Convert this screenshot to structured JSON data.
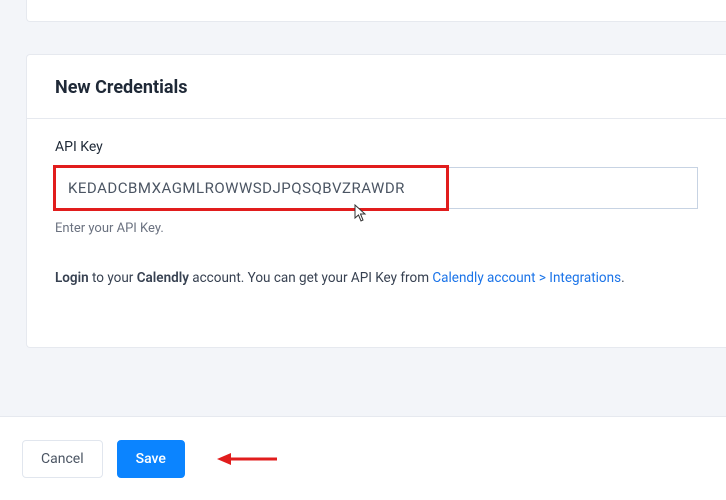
{
  "card": {
    "title": "New Credentials",
    "field_label": "API Key",
    "api_key_value": "KEDADCBMXAGMLROWWSDJPQSQBVZRAWDR",
    "hint": "Enter your API Key.",
    "info": {
      "prefix_bold": "Login",
      "middle1": " to your ",
      "middle_bold": "Calendly",
      "middle2": " account. You can get your API Key from ",
      "link_text": "Calendly account > Integrations",
      "suffix": "."
    }
  },
  "footer": {
    "cancel_label": "Cancel",
    "save_label": "Save"
  }
}
